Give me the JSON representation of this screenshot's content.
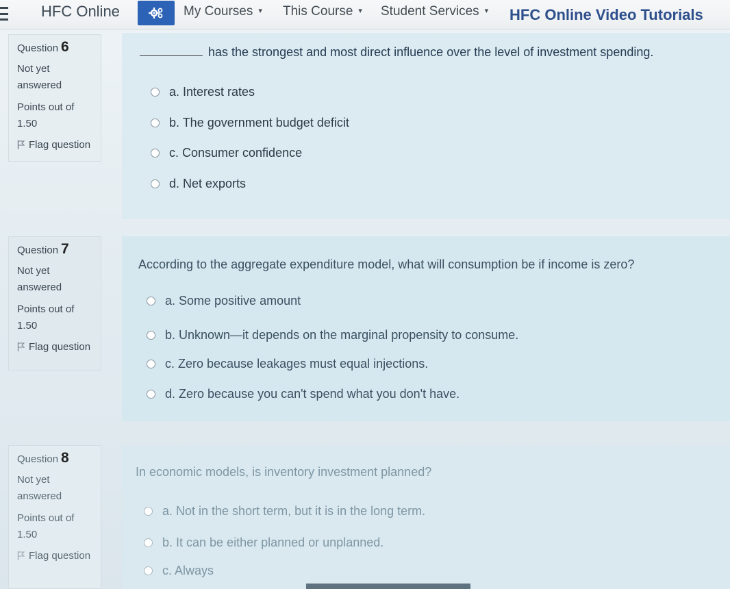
{
  "nav": {
    "brand": "HFC Online",
    "my_courses": "My Courses",
    "this_course": "This Course",
    "student_services": "Student Services",
    "video_tutorials": "HFC Online Video Tutorials",
    "caret": "▾"
  },
  "questions": [
    {
      "label": "Question",
      "number": "6",
      "state": "Not yet answered",
      "points": "Points out of 1.50",
      "flag": "Flag question",
      "text": "has the strongest and most direct influence over the level of investment spending.",
      "options": [
        "a. Interest rates",
        "b. The government budget deficit",
        "c. Consumer confidence",
        "d. Net exports"
      ]
    },
    {
      "label": "Question",
      "number": "7",
      "state": "Not yet answered",
      "points": "Points out of 1.50",
      "flag": "Flag question",
      "text": "According to the aggregate expenditure model, what will consumption be if income is zero?",
      "options": [
        "a. Some positive amount",
        "b. Unknown—it depends on the marginal propensity to consume.",
        "c. Zero because leakages must equal injections.",
        "d. Zero because you can't spend what you don't have."
      ]
    },
    {
      "label": "Question",
      "number": "8",
      "state": "Not yet answered",
      "points": "Points out of 1.50",
      "flag": "Flag question",
      "text": "In economic models, is inventory investment planned?",
      "options": [
        "a. Not in the short term, but it is in the long term.",
        "b. It can be either planned or unplanned.",
        "c. Always"
      ]
    }
  ],
  "colors": {
    "accent": "#2d63b6",
    "tutorials_link": "#2d4f8c"
  }
}
